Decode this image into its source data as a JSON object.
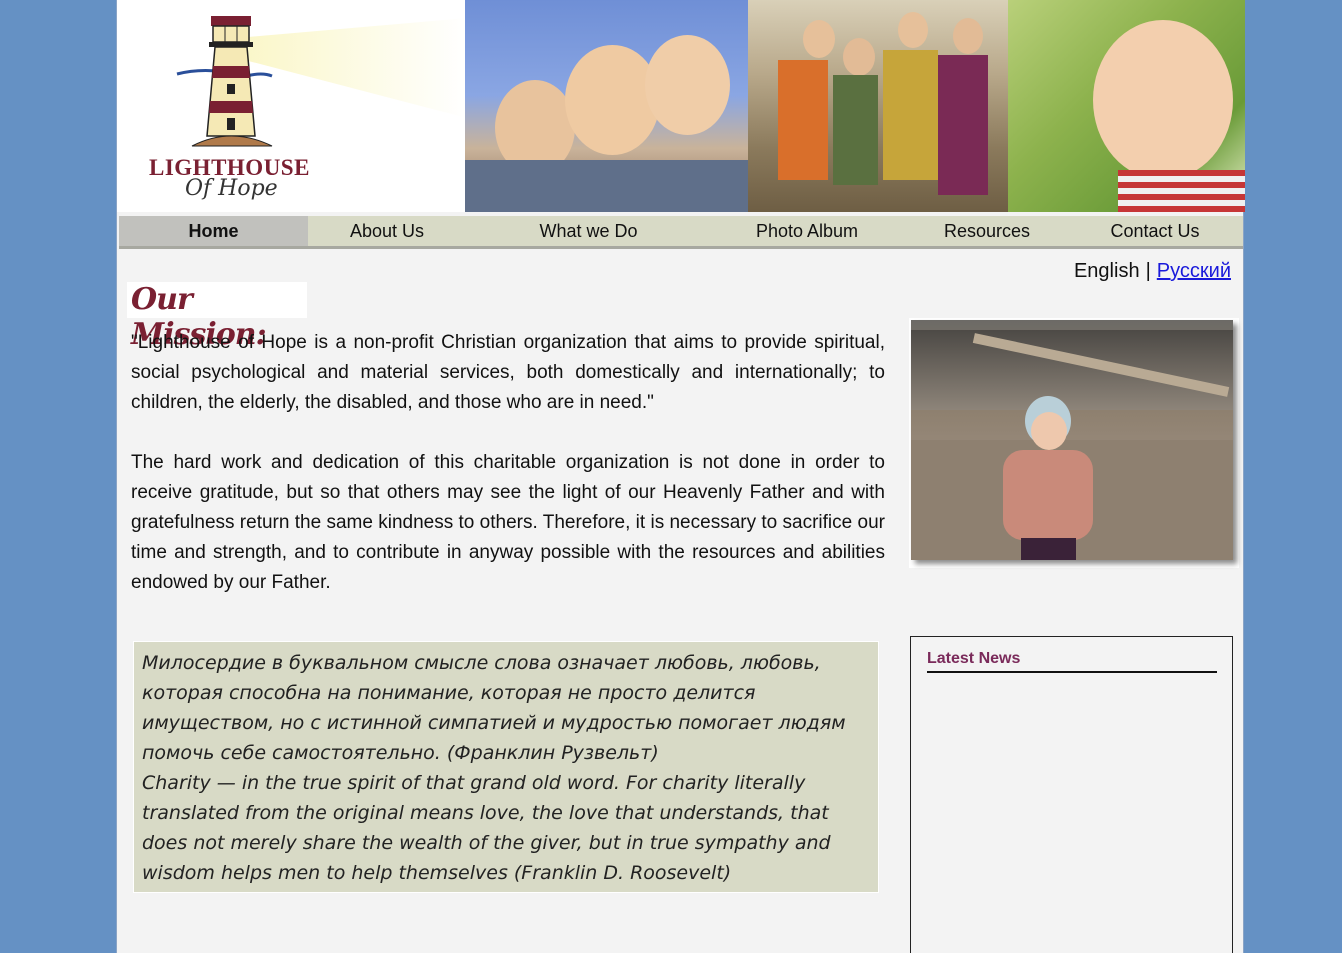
{
  "logo": {
    "line1": "LIGHTHOUSE",
    "line2": "Of Hope"
  },
  "nav": {
    "items": [
      {
        "label": "Home"
      },
      {
        "label": "About Us"
      },
      {
        "label": "What we Do"
      },
      {
        "label": "Photo Album"
      },
      {
        "label": "Resources"
      },
      {
        "label": "Contact Us"
      }
    ],
    "active": "Home"
  },
  "language": {
    "english": "English",
    "separator": "|",
    "russian": "Русский"
  },
  "mission": {
    "heading": "Our Mission:",
    "paragraph1": "\"Lighthouse of Hope is a non-profit Christian organization that aims to provide spiritual, social psychological and material services, both domestically and internationally; to children, the elderly, the disabled, and those who are in need.\"",
    "paragraph2": "The hard work and dedication of this charitable organization is not done in order to receive gratitude, but so that others may see the light of our Heavenly Father and with gratefulness return the same kindness to others. Therefore, it is necessary to sacrifice our time and strength, and to contribute in anyway possible with the resources and abilities endowed by our Father."
  },
  "quote": {
    "russian": "Милосердие в буквальном смысле слова означает любовь, любовь, которая способна на понимание, которая не просто делится имуществом, но с истинной симпатией и мудростью помогает людям помочь себе самостоятельно. (Франклин Рузвельт)",
    "english": "Charity — in the true spirit of that grand old word. For charity literally translated from the original means love, the love that understands, that does not merely share the wealth of the giver, but in true sympathy and wisdom helps men to help themselves (Franklin D. Roosevelt)"
  },
  "news": {
    "title": "Latest News"
  },
  "colors": {
    "background": "#6591c4",
    "nav": "#d8dac6",
    "accent": "#7a2032",
    "news_title": "#7a2a5a"
  }
}
